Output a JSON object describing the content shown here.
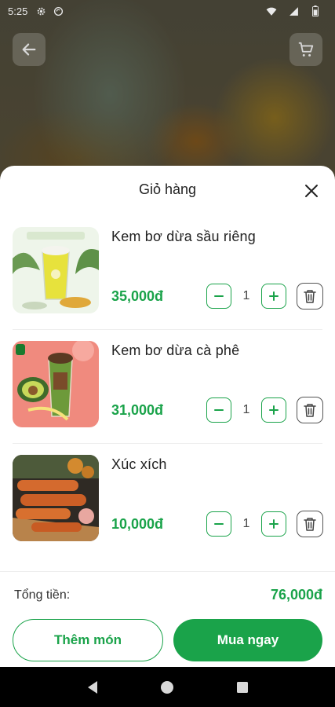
{
  "status_bar": {
    "time": "5:25",
    "icons": [
      "settings-icon",
      "sync-icon",
      "wifi-icon",
      "signal-icon",
      "battery-icon"
    ]
  },
  "header": {
    "back_icon": "arrow-left-icon",
    "cart_icon": "cart-icon"
  },
  "sheet": {
    "title": "Giỏ hàng",
    "close_icon": "close-icon"
  },
  "cart_items": [
    {
      "name": "Kem bơ dừa sầu riêng",
      "price": "35,000đ",
      "quantity": "1",
      "image": "durian-avocado-coconut-ice-cream"
    },
    {
      "name": "Kem bơ dừa cà phê",
      "price": "31,000đ",
      "quantity": "1",
      "image": "coffee-avocado-coconut-ice-cream"
    },
    {
      "name": "Xúc xích",
      "price": "10,000đ",
      "quantity": "1",
      "image": "grilled-sausages"
    }
  ],
  "summary": {
    "total_label": "Tổng tiền:",
    "total_value": "76,000đ"
  },
  "actions": {
    "add_more_label": "Thêm món",
    "buy_now_label": "Mua ngay"
  },
  "colors": {
    "accent": "#1aa34a",
    "text": "#222222",
    "sheet_background": "#ffffff"
  },
  "nav_bar": {
    "icons": [
      "back-triangle-icon",
      "home-circle-icon",
      "recents-square-icon"
    ]
  }
}
